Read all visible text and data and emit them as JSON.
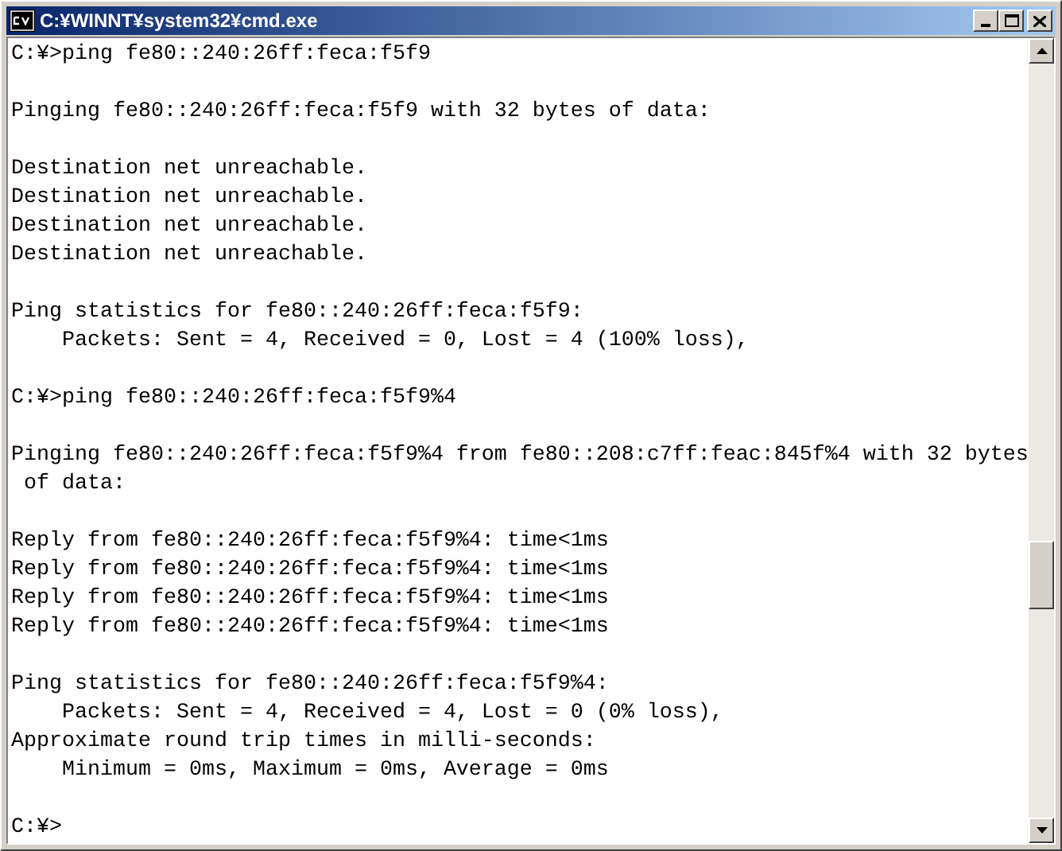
{
  "window": {
    "title": "C:¥WINNT¥system32¥cmd.exe"
  },
  "console": {
    "blocks": [
      [
        "C:¥>ping fe80::240:26ff:feca:f5f9"
      ],
      [
        "Pinging fe80::240:26ff:feca:f5f9 with 32 bytes of data:"
      ],
      [
        "Destination net unreachable.",
        "Destination net unreachable.",
        "Destination net unreachable.",
        "Destination net unreachable."
      ],
      [
        "Ping statistics for fe80::240:26ff:feca:f5f9:",
        "    Packets: Sent = 4, Received = 0, Lost = 4 (100% loss),"
      ],
      [
        "C:¥>ping fe80::240:26ff:feca:f5f9%4"
      ],
      [
        "Pinging fe80::240:26ff:feca:f5f9%4 from fe80::208:c7ff:feac:845f%4 with 32 bytes",
        " of data:"
      ],
      [
        "Reply from fe80::240:26ff:feca:f5f9%4: time<1ms",
        "Reply from fe80::240:26ff:feca:f5f9%4: time<1ms",
        "Reply from fe80::240:26ff:feca:f5f9%4: time<1ms",
        "Reply from fe80::240:26ff:feca:f5f9%4: time<1ms"
      ],
      [
        "Ping statistics for fe80::240:26ff:feca:f5f9%4:",
        "    Packets: Sent = 4, Received = 4, Lost = 0 (0% loss),",
        "Approximate round trip times in milli-seconds:",
        "    Minimum = 0ms, Maximum = 0ms, Average = 0ms"
      ],
      [
        "C:¥>"
      ]
    ]
  }
}
